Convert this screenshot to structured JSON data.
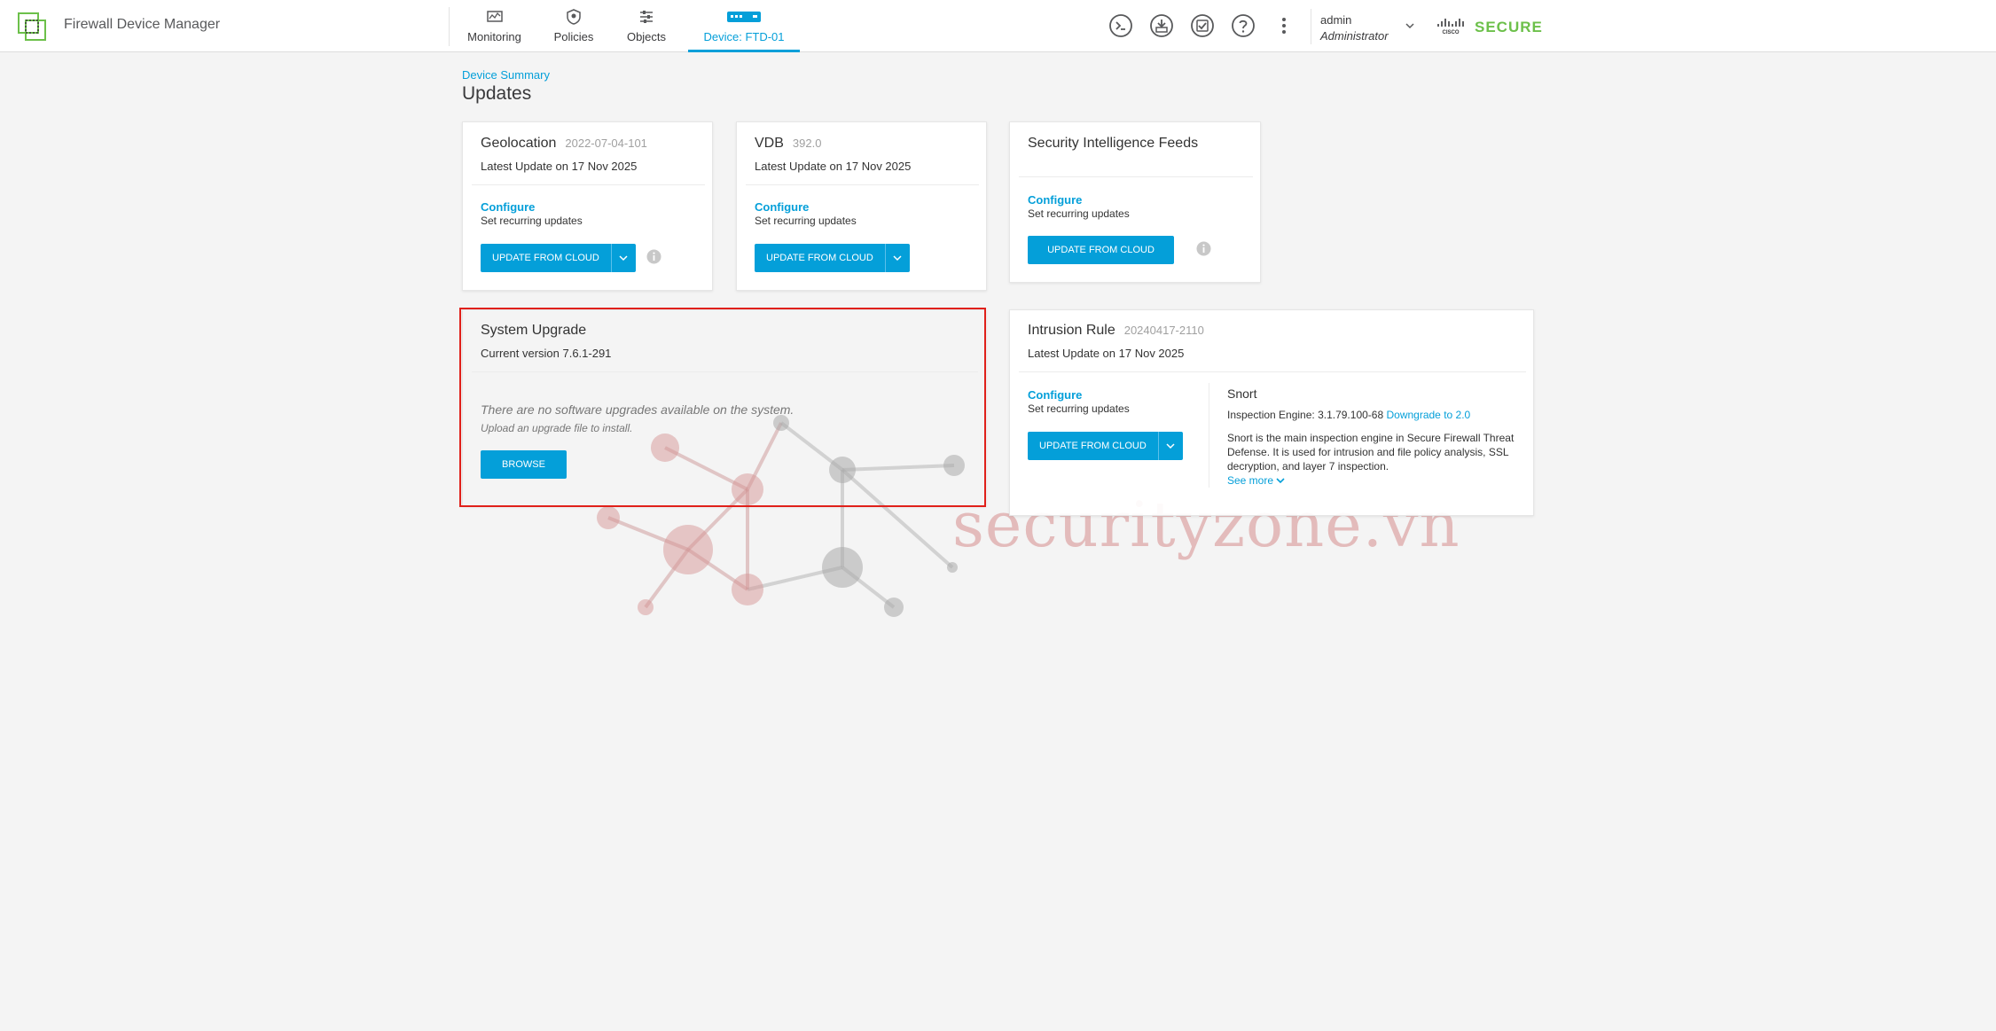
{
  "header": {
    "app_title": "Firewall Device Manager",
    "nav": [
      {
        "label": "Monitoring",
        "icon": "monitoring-icon"
      },
      {
        "label": "Policies",
        "icon": "policies-icon"
      },
      {
        "label": "Objects",
        "icon": "objects-icon"
      },
      {
        "label": "Device: FTD-01",
        "icon": "device-icon",
        "active": true
      }
    ],
    "actions": [
      "cli-console-icon",
      "deploy-icon",
      "task-list-icon",
      "help-icon",
      "more-menu-icon"
    ],
    "user": {
      "name": "admin",
      "role": "Administrator"
    },
    "brand": {
      "text": "SECURE",
      "color": "#6cc04a"
    }
  },
  "page": {
    "breadcrumb": "Device Summary",
    "title": "Updates"
  },
  "cards": {
    "geolocation": {
      "title": "Geolocation",
      "version": "2022-07-04-101",
      "latest": "Latest Update on 17 Nov 2025",
      "configure": "Configure",
      "helper": "Set recurring updates",
      "button": "UPDATE FROM CLOUD"
    },
    "vdb": {
      "title": "VDB",
      "version": "392.0",
      "latest": "Latest Update on 17 Nov 2025",
      "configure": "Configure",
      "helper": "Set recurring updates",
      "button": "UPDATE FROM CLOUD"
    },
    "sif": {
      "title": "Security Intelligence Feeds",
      "configure": "Configure",
      "helper": "Set recurring updates",
      "button": "UPDATE FROM CLOUD"
    },
    "system_upgrade": {
      "title": "System Upgrade",
      "current": "Current version 7.6.1-291",
      "no_upgrades": "There are no software upgrades available on the system.",
      "upload_hint": "Upload an upgrade file to install.",
      "button": "BROWSE"
    },
    "intrusion": {
      "title": "Intrusion Rule",
      "version": "20240417-2110",
      "latest": "Latest Update on 17 Nov 2025",
      "configure": "Configure",
      "helper": "Set recurring updates",
      "button": "UPDATE FROM CLOUD",
      "snort": {
        "title": "Snort",
        "engine_label": "Inspection Engine: 3.1.79.100-68",
        "downgrade": "Downgrade to 2.0",
        "description": "Snort is the main inspection engine in Secure Firewall Threat Defense. It is used for intrusion and file policy analysis, SSL decryption, and layer 7 inspection.",
        "see_more": "See more"
      }
    }
  },
  "watermark": "securityzone.vn",
  "colors": {
    "accent": "#049fd9",
    "highlight": "#e0201a",
    "background": "#f4f4f4"
  }
}
